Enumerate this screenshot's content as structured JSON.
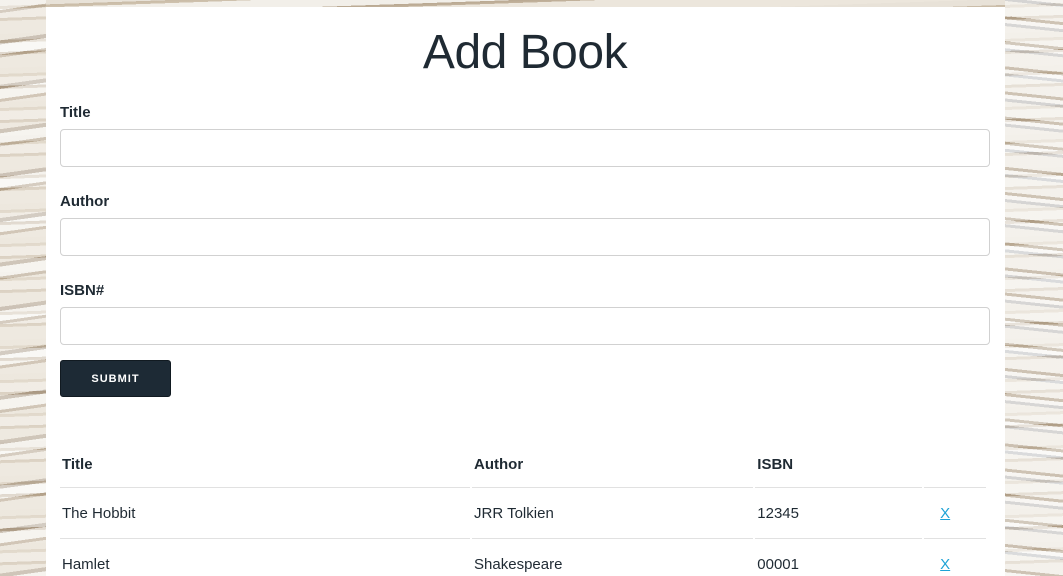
{
  "page": {
    "title": "Add Book"
  },
  "form": {
    "title_label": "Title",
    "title_value": "",
    "author_label": "Author",
    "author_value": "",
    "isbn_label": "ISBN#",
    "isbn_value": "",
    "submit_label": "SUBMIT"
  },
  "table": {
    "headers": [
      "Title",
      "Author",
      "ISBN",
      ""
    ],
    "rows": [
      {
        "title": "The Hobbit",
        "author": "JRR Tolkien",
        "isbn": "12345",
        "delete_label": "X"
      },
      {
        "title": "Hamlet",
        "author": "Shakespeare",
        "isbn": "00001",
        "delete_label": "X"
      }
    ]
  },
  "colors": {
    "button_bg": "#1d2a35",
    "link": "#1ea3d6",
    "text": "#1f2a33"
  }
}
